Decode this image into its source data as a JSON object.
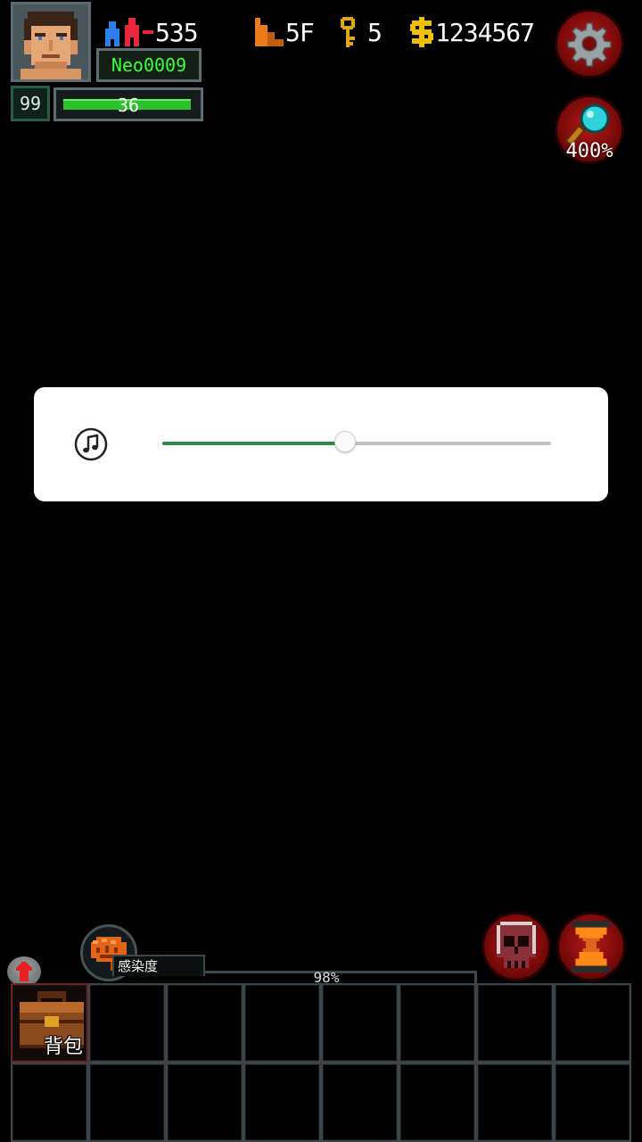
{
  "hud": {
    "player_name": "Neo0009",
    "level": "99",
    "hp": {
      "label": "36",
      "fraction": 0.98
    },
    "population": "535",
    "floor": "5F",
    "keys": "5",
    "gold": "1234567",
    "zoom": "400%"
  },
  "volume": {
    "icon": "music-note-icon",
    "level_fraction": 0.47
  },
  "infection": {
    "label": "感染度",
    "percent": "98%"
  },
  "inventory": {
    "bag_label": "背包",
    "rows": 2,
    "columns": 8
  },
  "colors": {
    "name_text": "#3cff3c",
    "hp_bar": "#2bc22b",
    "slider_active": "#2e8b44",
    "button_red": "#b61818"
  }
}
